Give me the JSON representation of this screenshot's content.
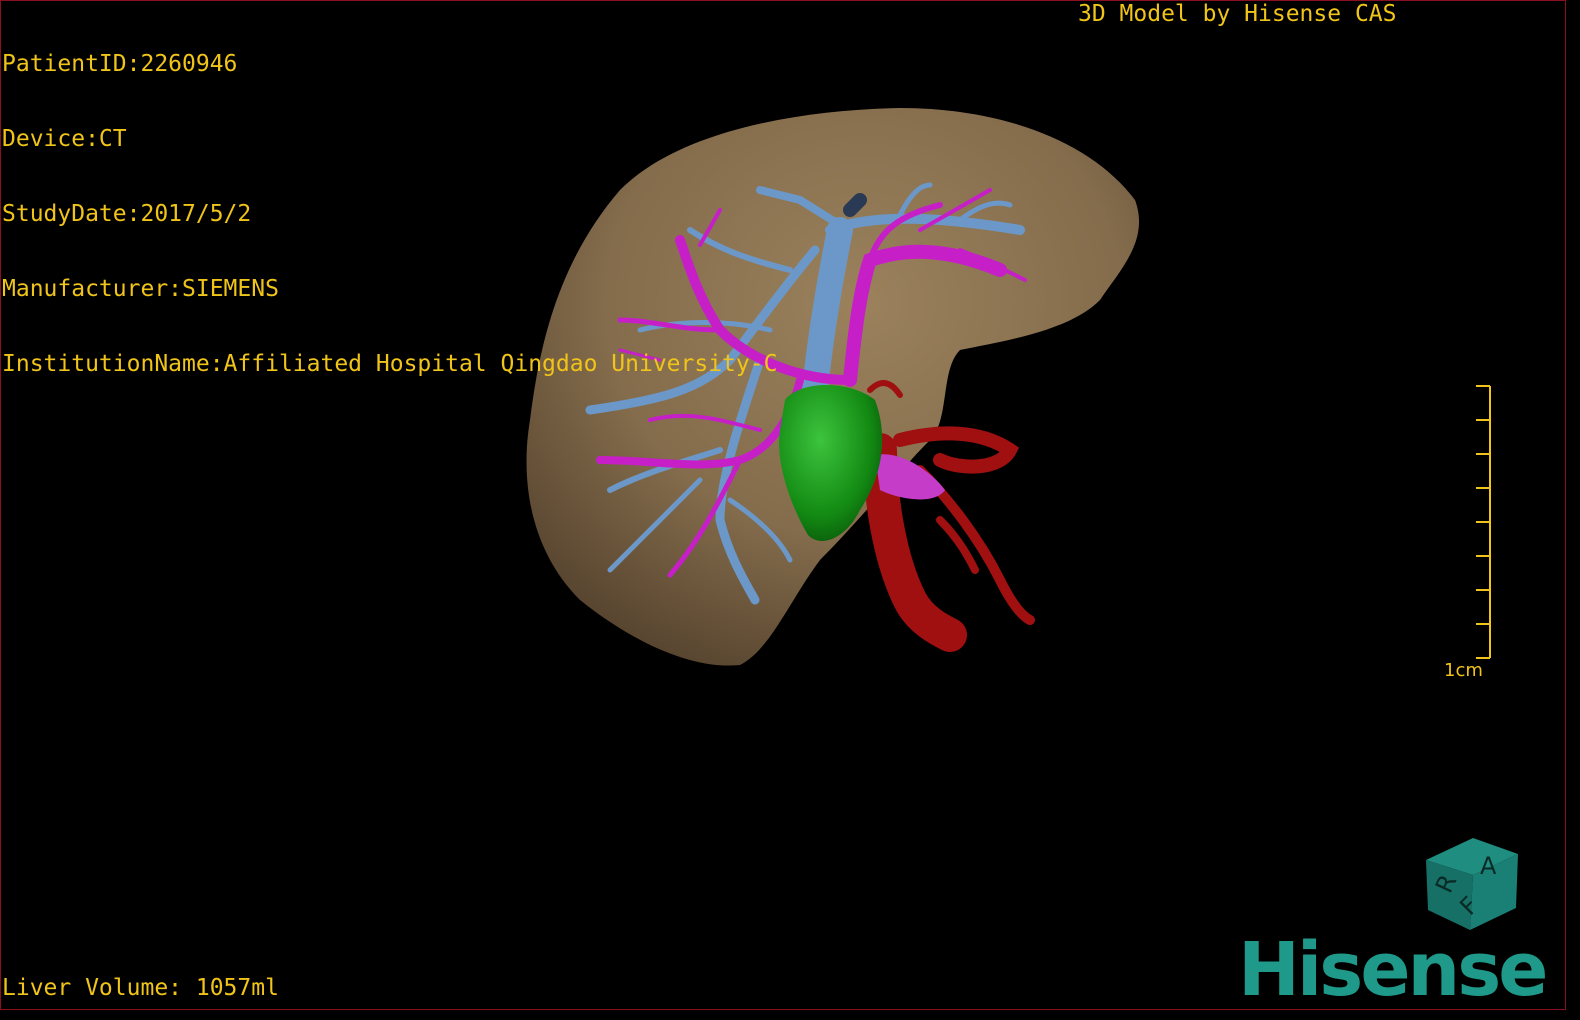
{
  "overlay": {
    "patient_id": "PatientID:2260946",
    "device": "Device:CT",
    "study_date": "StudyDate:2017/5/2",
    "manufacturer": "Manufacturer:SIEMENS",
    "institution": "InstitutionName:Affiliated Hospital Qingdao University-C",
    "credit": "3D Model by Hisense CAS",
    "liver_volume": "Liver Volume: 1057ml"
  },
  "scale_bar": {
    "label": "1cm"
  },
  "orientation_cube": {
    "faces": [
      "A",
      "R",
      "F"
    ]
  },
  "brand": {
    "logo_text": "Hisense"
  },
  "colors": {
    "overlay_text": "#f0c419",
    "liver": "#8b7250",
    "portal_vein": "#c61fc8",
    "hepatic_vein": "#6c98c9",
    "tumor": "#1a8a1a",
    "artery": "#a01010",
    "brand": "#1f9a8a"
  },
  "icons": [
    "orientation-cube-icon",
    "scale-bar-icon"
  ]
}
